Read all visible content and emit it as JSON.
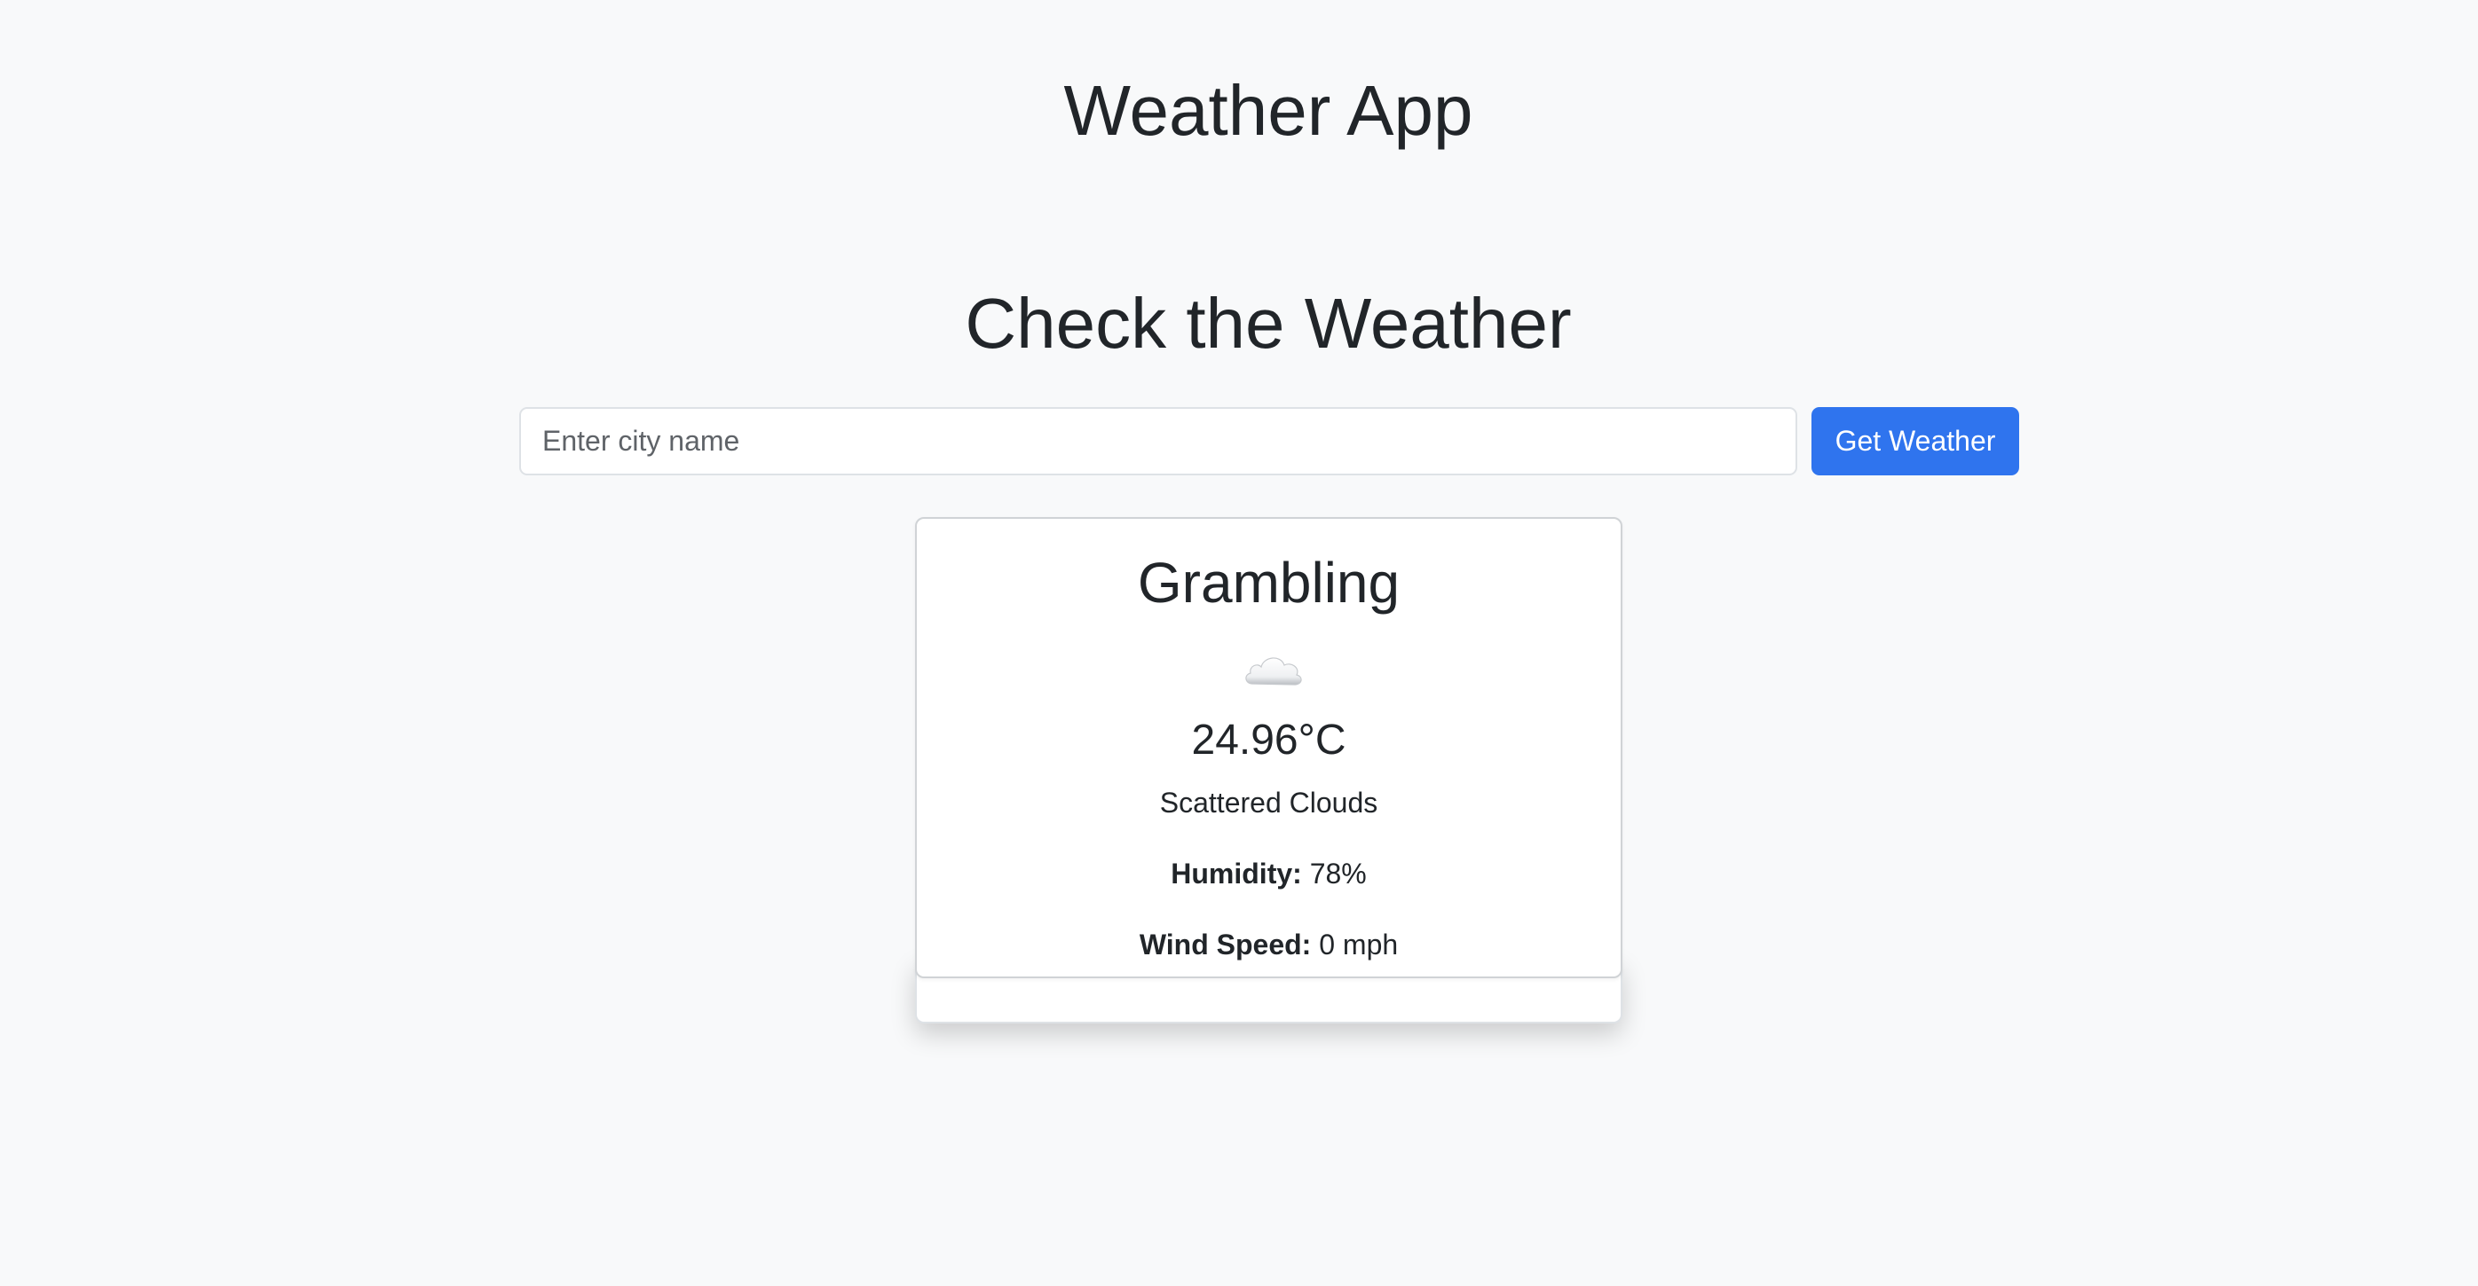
{
  "header": {
    "title": "Weather App"
  },
  "search": {
    "heading": "Check the Weather",
    "placeholder": "Enter city name",
    "value": "",
    "button_label": "Get Weather"
  },
  "weather": {
    "city": "Grambling",
    "icon": "cloud-icon",
    "temperature": "24.96°C",
    "description": "Scattered Clouds",
    "humidity_label": "Humidity:",
    "humidity_value": "78%",
    "wind_label": "Wind Speed:",
    "wind_value": "0 mph"
  },
  "colors": {
    "background": "#f8f9fa",
    "accent": "#2f74ee",
    "text": "#212529"
  }
}
